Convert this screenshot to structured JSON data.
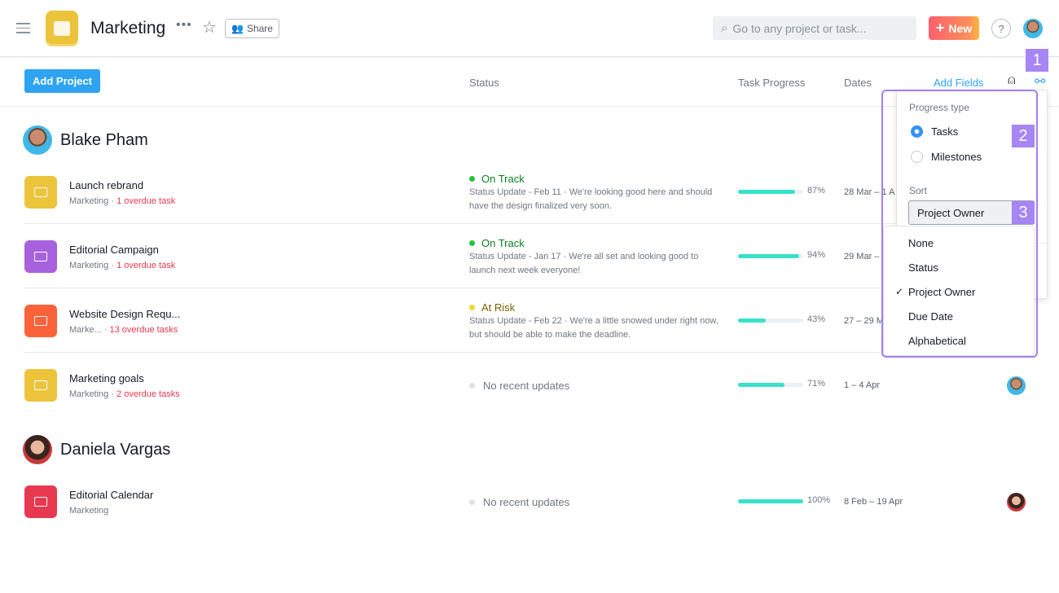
{
  "header": {
    "title": "Marketing",
    "share_label": "Share",
    "search_placeholder": "Go to any project or task...",
    "new_label": "New",
    "help_label": "?"
  },
  "toolbar": {
    "add_project": "Add Project",
    "col_status": "Status",
    "col_progress": "Task Progress",
    "col_dates": "Dates",
    "add_fields": "Add Fields"
  },
  "groups": [
    {
      "owner": "Blake Pham",
      "rows": [
        {
          "name": "Launch rebrand",
          "team": "Marketing",
          "overdue": "1 overdue task",
          "icon_color": "#ecc43c",
          "status": "On Track",
          "status_color": "#25c33e",
          "update": "Status Update - Feb 11 · We're looking good here and should have the design finalized very soon.",
          "progress": 87,
          "pct": "87%",
          "dates": "28 Mar – 1 A"
        },
        {
          "name": "Editorial Campaign",
          "team": "Marketing",
          "overdue": "1 overdue task",
          "icon_color": "#a761dc",
          "status": "On Track",
          "status_color": "#25c33e",
          "update": "Status Update - Jan 17 · We're all set and looking good to launch next week everyone!",
          "progress": 94,
          "pct": "94%",
          "dates": "29 Mar –"
        },
        {
          "name": "Website Design Requ...",
          "team": "Marke...",
          "overdue": "13 overdue tasks",
          "icon_color": "#fc6239",
          "status": "At Risk",
          "status_color": "#f5d535",
          "update": "Status Update - Feb 22 · We're a little snowed under right now, but should be able to make the deadline.",
          "progress": 43,
          "pct": "43%",
          "dates": "27 – 29 M"
        },
        {
          "name": "Marketing goals",
          "team": "Marketing",
          "overdue": "2 overdue tasks",
          "icon_color": "#ecc43c",
          "status": "No recent updates",
          "progress": 71,
          "pct": "71%",
          "dates": "1 – 4 Apr"
        }
      ]
    },
    {
      "owner": "Daniela Vargas",
      "rows": [
        {
          "name": "Editorial Calendar",
          "team": "Marketing",
          "icon_color": "#e8384f",
          "status": "No recent updates",
          "progress": 100,
          "pct": "100%",
          "dates": "8 Feb – 19 Apr"
        }
      ]
    }
  ],
  "popover": {
    "progress_type_label": "Progress type",
    "options": [
      "Tasks",
      "Milestones"
    ],
    "selected": "Tasks",
    "sort_label": "Sort",
    "sort_value": "Project Owner",
    "sort_options": [
      "None",
      "Status",
      "Project Owner",
      "Due Date",
      "Alphabetical"
    ],
    "check": "✓"
  },
  "annotations": [
    "1",
    "2",
    "3"
  ],
  "colors": {
    "accent": "#2ea3f2",
    "highlight": "#a685f5",
    "progress": "#37e2c6"
  }
}
